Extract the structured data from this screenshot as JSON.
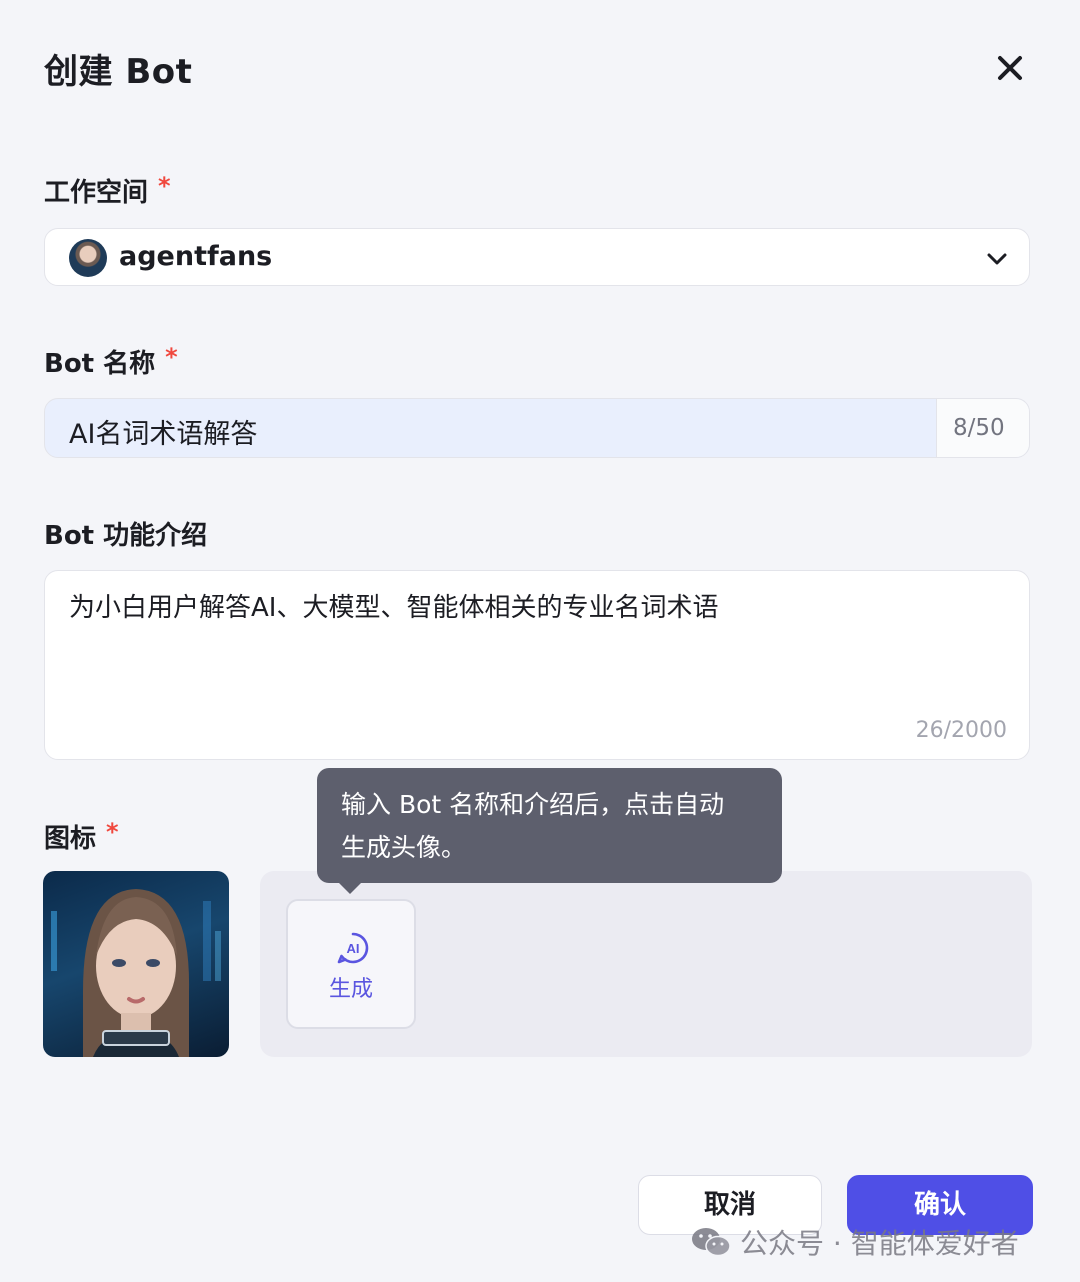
{
  "dialog": {
    "title": "创建 Bot",
    "close_icon": "close-icon"
  },
  "workspace": {
    "label": "工作空间",
    "required_mark": "*",
    "selected": "agentfans",
    "chevron_icon": "chevron-down-icon"
  },
  "bot_name": {
    "label": "Bot 名称",
    "required_mark": "*",
    "value": "AI名词术语解答",
    "counter": "8/50"
  },
  "bot_description": {
    "label": "Bot 功能介绍",
    "value": "为小白用户解答AI、大模型、智能体相关的专业名词术语",
    "counter": "26/2000"
  },
  "icon_section": {
    "label": "图标",
    "required_mark": "*",
    "tooltip": "输入 Bot 名称和介绍后，点击自动生成头像。",
    "tooltip_line1": "输入 Bot 名称和介绍后，点击自动",
    "tooltip_line2": "生成头像。",
    "generate_label": "生成",
    "generate_icon": "ai-sparkle-icon"
  },
  "footer": {
    "cancel_label": "取消",
    "confirm_label": "确认"
  },
  "watermark": {
    "text": "公众号 · 智能体爱好者",
    "icon": "wechat-icon"
  },
  "colors": {
    "accent": "#4f4fe6",
    "required": "#f0483e",
    "input_focus_bg": "#e9effd",
    "tooltip_bg": "#5d5f6d"
  }
}
